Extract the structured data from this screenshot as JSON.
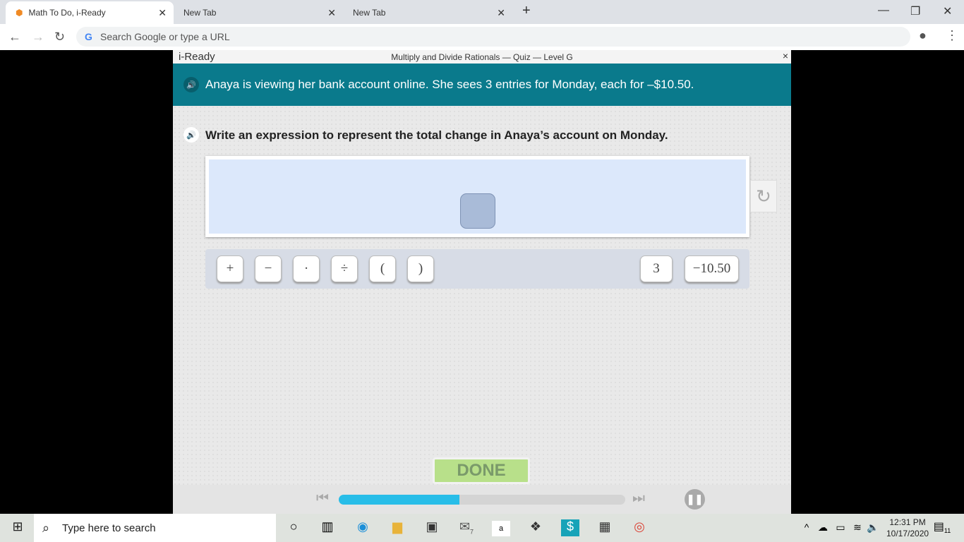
{
  "browser": {
    "tabs": [
      {
        "label": "Math To Do, i-Ready",
        "active": true
      },
      {
        "label": "New Tab"
      },
      {
        "label": "New Tab"
      }
    ],
    "omnibox_placeholder": "Search Google or type a URL"
  },
  "app": {
    "logo": "i-Ready",
    "title": "Multiply and Divide Rationals — Quiz — Level G",
    "close": "×",
    "banner": "Anaya is viewing her bank account online. She sees 3 entries for Monday, each for –$10.50.",
    "question": "Write an expression to represent the total change in Anaya’s account on Monday.",
    "operators": [
      "+",
      "−",
      "·",
      "÷",
      "(",
      ")"
    ],
    "tiles": [
      "3",
      "−10.50"
    ],
    "done_label": "DONE",
    "progress_percent": 42,
    "colors": {
      "banner": "#0a7a8c",
      "progress": "#28bde8",
      "done": "#b8e08a"
    }
  },
  "taskbar": {
    "search_placeholder": "Type here to search",
    "time": "12:31 PM",
    "date": "10/17/2020",
    "mail_badge": "7",
    "notifications": "11"
  }
}
